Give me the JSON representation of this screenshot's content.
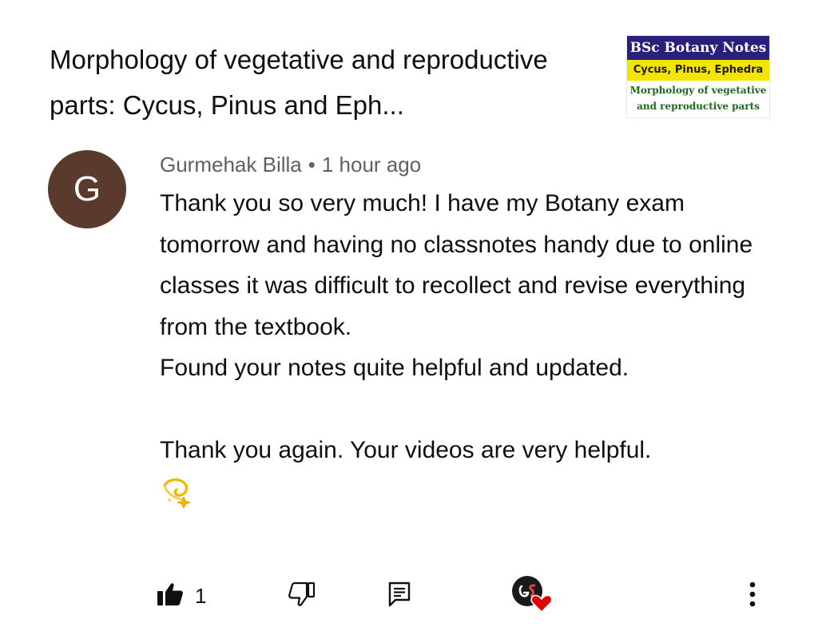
{
  "video": {
    "title": "Morphology of vegetative and reproductive parts: Cycus, Pinus and Eph...",
    "thumbnail": {
      "line1": "BSc Botany Notes",
      "line2": "Cycus, Pinus, Ephedra",
      "line3a": "Morphology of vegetative",
      "line3b": "and reproductive parts"
    }
  },
  "comment": {
    "avatar_letter": "G",
    "author": "Gurmehak Billa",
    "separator": "•",
    "time": "1 hour ago",
    "body_para1": "Thank you so very much! I have my Botany exam tomorrow and having no classnotes handy due to online classes it was difficult to recollect and revise everything from the textbook.",
    "body_para2": "Found your notes quite helpful and updated.",
    "body_para3": "Thank you again. Your videos are very helpful.",
    "emoji_icon": "dizzy-sparkle-icon"
  },
  "actions": {
    "like_count": "1",
    "like_icon": "thumbs-up-filled-icon",
    "dislike_icon": "thumbs-down-icon",
    "reply_icon": "reply-comment-icon",
    "creator_heart_icon": "creator-heart-icon",
    "more_icon": "more-vert-icon"
  },
  "colors": {
    "avatar_bg": "#5b3a2e",
    "meta_text": "#606060",
    "text": "#0f0f0f",
    "heart": "#e00000",
    "thumb_banner": "#2b1f7c",
    "thumb_strip": "#f5e400",
    "thumb_green": "#1b6b1b"
  }
}
